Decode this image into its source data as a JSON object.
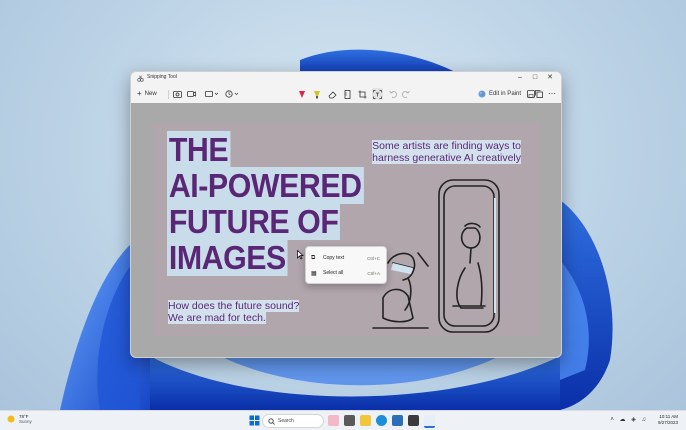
{
  "window": {
    "title": "Snipping Tool",
    "new_label": "New",
    "edit_in_paint_label": "Edit in Paint"
  },
  "capture": {
    "headline": [
      "THE",
      "AI-POWERED",
      "FUTURE OF",
      "IMAGES"
    ],
    "subtitle": [
      "Some artists are finding ways to",
      "harness generative AI creatively"
    ],
    "bottom_text": [
      "How does the future sound?",
      "We are mad for tech."
    ]
  },
  "context_menu": {
    "items": [
      {
        "label": "Copy text",
        "shortcut": "Ctrl+C"
      },
      {
        "label": "Select all",
        "shortcut": "Ctrl+A"
      }
    ]
  },
  "taskbar": {
    "weather_temp": "78°F",
    "weather_condition": "Sunny",
    "search_placeholder": "Search",
    "time": "10:11 AM",
    "date": "9/27/2023"
  },
  "colors": {
    "headline": "#5a2676",
    "highlight": "#c8dde9",
    "capture_bg": "#b1a6ac"
  }
}
